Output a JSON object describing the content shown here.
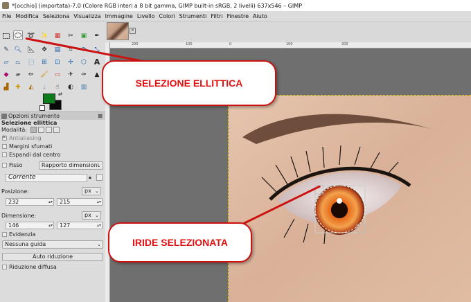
{
  "window": {
    "title": "*[occhio] (importata)-7.0 (Colore RGB interi a 8 bit gamma, GIMP built-in sRGB, 2 livelli) 637x546 – GIMP"
  },
  "menubar": [
    "File",
    "Modifica",
    "Seleziona",
    "Visualizza",
    "Immagine",
    "Livello",
    "Colori",
    "Strumenti",
    "Filtri",
    "Finestre",
    "Aiuto"
  ],
  "toolbox": {
    "active_tool": "ellipse-select",
    "colors": {
      "foreground": "#0d7c1b",
      "background": "#0a0a0a"
    }
  },
  "tool_options": {
    "tab_label": "Opzioni strumento",
    "tool_name": "Selezione ellittica",
    "mode_label": "Modalità:",
    "antialiasing": {
      "label": "Antialiasing",
      "checked": true
    },
    "margini_sfumati": {
      "label": "Margini sfumati",
      "checked": false
    },
    "espandi_centro": {
      "label": "Espandi dal centro",
      "checked": false
    },
    "fisso": {
      "label": "Fisso",
      "checked": false,
      "dropdown": "Rapporto dimensioni"
    },
    "corrente_value": "Corrente",
    "position": {
      "label": "Posizione:",
      "unit": "px",
      "x": "232",
      "y": "215"
    },
    "size": {
      "label": "Dimensione:",
      "unit": "px",
      "w": "146",
      "h": "127"
    },
    "evidenzia": {
      "label": "Evidenzia",
      "checked": false
    },
    "guide_dropdown": "Nessuna guida",
    "auto_button": "Auto riduzione",
    "riduzione_diffusa": {
      "label": "Riduzione diffusa",
      "checked": false
    }
  },
  "rulers": {
    "top_ticks": [
      "200",
      "100",
      "0",
      "100",
      "200"
    ]
  },
  "annotations": {
    "callout_1": "SELEZIONE ELLITTICA",
    "callout_2": "IRIDE SELEZIONATA"
  }
}
